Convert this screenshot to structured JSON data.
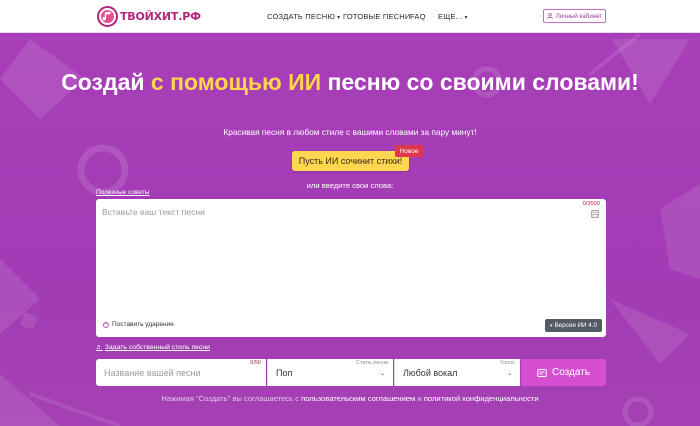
{
  "header": {
    "logo_text": "ТВОЙХИТ.РФ",
    "nav": [
      {
        "label": "СОЗДАТЬ ПЕСНЮ",
        "has_dropdown": true
      },
      {
        "label": "ГОТОВЫЕ ПЕСНИ",
        "has_dropdown": false
      },
      {
        "label": "FAQ",
        "has_dropdown": false
      },
      {
        "label": "ЕЩЕ...",
        "has_dropdown": true
      }
    ],
    "cabinet_label": "Личный кабинет"
  },
  "hero": {
    "title_part1": "Создай ",
    "title_highlight": "с помощью ИИ",
    "title_part2": " песню со своими словами!",
    "subtitle": "Красивая песня в любом стиле с вашими словами за пару минут!",
    "ai_button": "Пусть ИИ сочинит стихи!",
    "new_badge": "Новое",
    "or_text": "или введите свои слова:"
  },
  "editor": {
    "tips_link": "Полезные советы",
    "placeholder": "Вставьте ваш текст песни",
    "counter": "0/3500",
    "stress_label": "Поставить ударение",
    "version_label": "Версия ИИ 4.0"
  },
  "form": {
    "style_link": "Задать собственный стиль песни",
    "name_placeholder": "Название вашей песни",
    "name_counter": "0/50",
    "style_label": "Стиль песни",
    "style_value": "Поп",
    "voice_label": "Голос",
    "voice_value": "Любой вокал",
    "create_button": "Создать"
  },
  "agreement": {
    "prefix": "Нажимая \"Создать\" вы соглашаетесь с ",
    "link1": "пользовательским соглашением",
    "middle": " и ",
    "link2": "политикой конфиденциальности"
  },
  "colors": {
    "brand": "#b3247b",
    "background": "#a23db8",
    "highlight": "#ffd54b",
    "create_button": "#d64fd0"
  }
}
